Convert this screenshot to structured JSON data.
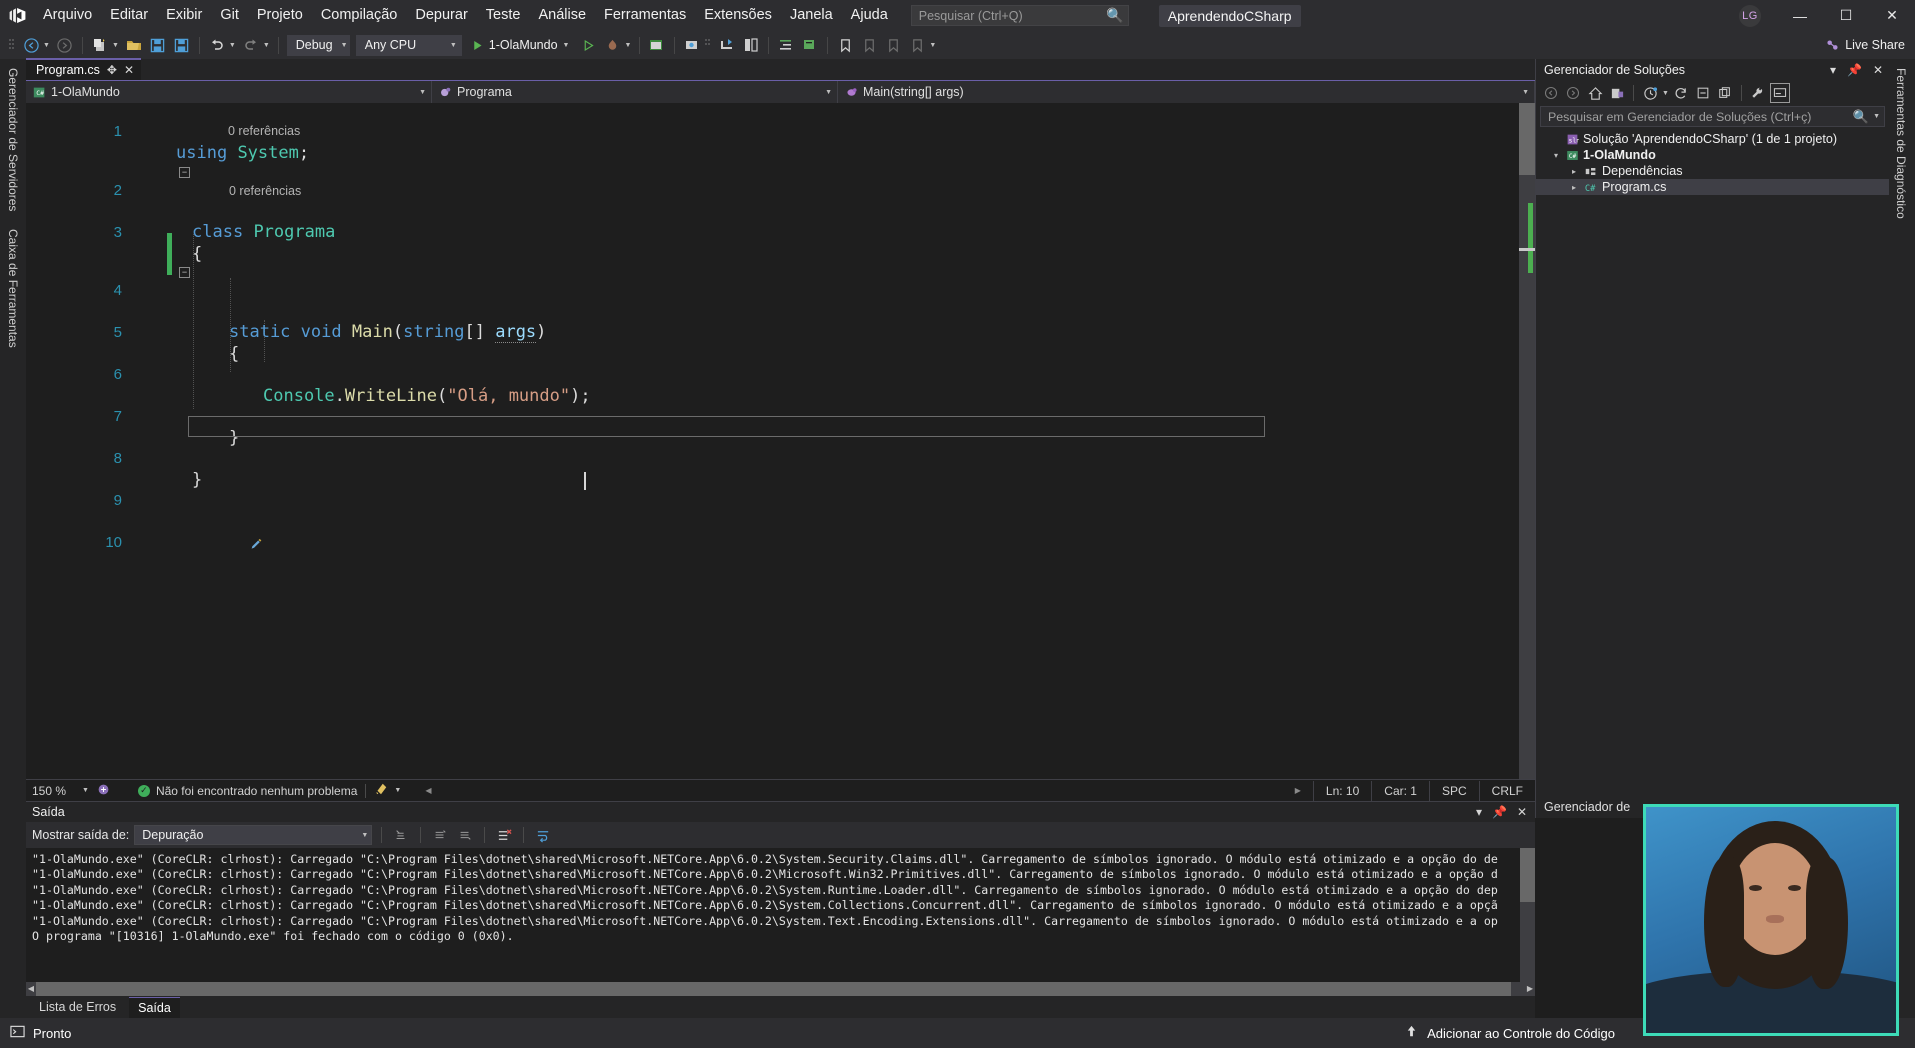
{
  "window": {
    "app_icon": "visual-studio-logo",
    "solution_name": "AprendendoCSharp",
    "user_initials": "LG",
    "minimize": "—",
    "maximize": "☐",
    "close": "✕"
  },
  "menu": {
    "items": [
      "Arquivo",
      "Editar",
      "Exibir",
      "Git",
      "Projeto",
      "Compilação",
      "Depurar",
      "Teste",
      "Análise",
      "Ferramentas",
      "Extensões",
      "Janela",
      "Ajuda"
    ]
  },
  "search": {
    "placeholder": "Pesquisar (Ctrl+Q)",
    "icon": "magnifier-icon"
  },
  "toolbar": {
    "back": "navigate-back-icon",
    "forward": "navigate-forward-icon",
    "new_project": "new-project-icon",
    "open": "open-folder-icon",
    "save": "save-icon",
    "save_all": "save-all-icon",
    "undo": "undo-icon",
    "redo": "redo-icon",
    "configuration": "Debug",
    "platform": "Any CPU",
    "start_label": "1-OlaMundo",
    "start_icon": "play-icon",
    "start_no_debug_icon": "play-outline-icon",
    "hot_reload_icon": "hot-reload-icon",
    "live_share": "Live Share",
    "live_share_icon": "live-share-icon"
  },
  "left_strip": {
    "tabs": [
      "Gerenciador de Servidores",
      "Caixa de Ferramentas"
    ]
  },
  "right_strip": {
    "tabs": [
      "Ferramentas de Diagnóstico"
    ]
  },
  "editor": {
    "tab": {
      "title": "Program.cs",
      "pin": "✥",
      "close": "✕"
    },
    "navbar": {
      "project": "1-OlaMundo",
      "project_icon": "csharp-project-icon",
      "type": "Programa",
      "type_icon": "class-icon",
      "member": "Main(string[] args)",
      "member_icon": "method-icon"
    },
    "lines": [
      {
        "n": "1",
        "segments": [
          {
            "t": "using",
            "c": "k"
          },
          {
            "t": " ",
            "c": "p"
          },
          {
            "t": "System",
            "c": "t"
          },
          {
            "t": ";",
            "c": "p"
          }
        ]
      },
      {
        "n": "2",
        "segments": [
          {
            "t": "class",
            "c": "k"
          },
          {
            "t": " ",
            "c": "p"
          },
          {
            "t": "Programa",
            "c": "t"
          }
        ],
        "indent": 0,
        "fold": "−",
        "ref": "0 referências"
      },
      {
        "n": "3",
        "segments": [
          {
            "t": "{",
            "c": "p"
          }
        ],
        "indent": 1
      },
      {
        "n": "4",
        "segments": [
          {
            "t": "static",
            "c": "k"
          },
          {
            "t": " ",
            "c": "p"
          },
          {
            "t": "void",
            "c": "k"
          },
          {
            "t": " ",
            "c": "p"
          },
          {
            "t": "Main",
            "c": "m"
          },
          {
            "t": "(",
            "c": "p"
          },
          {
            "t": "string",
            "c": "k"
          },
          {
            "t": "[] ",
            "c": "p"
          },
          {
            "t": "args",
            "c": "id"
          },
          {
            "t": ")",
            "c": "p"
          }
        ],
        "indent": 2,
        "fold": "−",
        "ref": "0 referências"
      },
      {
        "n": "5",
        "segments": [
          {
            "t": "{",
            "c": "p"
          }
        ],
        "indent": 2
      },
      {
        "n": "6",
        "segments": [
          {
            "t": "Console",
            "c": "t"
          },
          {
            "t": ".",
            "c": "p"
          },
          {
            "t": "WriteLine",
            "c": "m"
          },
          {
            "t": "(",
            "c": "p"
          },
          {
            "t": "\"Olá, mundo\"",
            "c": "s"
          },
          {
            "t": ");",
            "c": "p"
          }
        ],
        "indent": 3,
        "changed": true
      },
      {
        "n": "7",
        "segments": [
          {
            "t": "}",
            "c": "p"
          }
        ],
        "indent": 2,
        "changed": true
      },
      {
        "n": "8",
        "segments": [
          {
            "t": "}",
            "c": "p"
          }
        ],
        "indent": 1
      },
      {
        "n": "9",
        "segments": []
      },
      {
        "n": "10",
        "segments": [],
        "current": true,
        "marker": "edit-pencil-icon"
      }
    ],
    "status": {
      "zoom": "150 %",
      "problems": "Não foi encontrado nenhum problema",
      "problems_icon": "check-circle-icon",
      "brush_icon": "code-cleanup-icon",
      "line": "Ln: 10",
      "column": "Car: 1",
      "spaces": "SPC",
      "eol": "CRLF"
    }
  },
  "output": {
    "title": "Saída",
    "show_output_label": "Mostrar saída de:",
    "source": "Depuração",
    "icons": [
      "find-message-icon",
      "go-to-previous-icon",
      "go-to-next-icon",
      "clear-all-icon",
      "toggle-word-wrap-icon"
    ],
    "lines": [
      "\"1-OlaMundo.exe\" (CoreCLR: clrhost): Carregado \"C:\\Program Files\\dotnet\\shared\\Microsoft.NETCore.App\\6.0.2\\System.Security.Claims.dll\". Carregamento de símbolos ignorado. O módulo está otimizado e a opção do de",
      "\"1-OlaMundo.exe\" (CoreCLR: clrhost): Carregado \"C:\\Program Files\\dotnet\\shared\\Microsoft.NETCore.App\\6.0.2\\Microsoft.Win32.Primitives.dll\". Carregamento de símbolos ignorado. O módulo está otimizado e a opção d",
      "\"1-OlaMundo.exe\" (CoreCLR: clrhost): Carregado \"C:\\Program Files\\dotnet\\shared\\Microsoft.NETCore.App\\6.0.2\\System.Runtime.Loader.dll\". Carregamento de símbolos ignorado. O módulo está otimizado e a opção do dep",
      "\"1-OlaMundo.exe\" (CoreCLR: clrhost): Carregado \"C:\\Program Files\\dotnet\\shared\\Microsoft.NETCore.App\\6.0.2\\System.Collections.Concurrent.dll\". Carregamento de símbolos ignorado. O módulo está otimizado e a opçã",
      "\"1-OlaMundo.exe\" (CoreCLR: clrhost): Carregado \"C:\\Program Files\\dotnet\\shared\\Microsoft.NETCore.App\\6.0.2\\System.Text.Encoding.Extensions.dll\". Carregamento de símbolos ignorado. O módulo está otimizado e a op",
      "O programa \"[10316] 1-OlaMundo.exe\" foi fechado com o código 0 (0x0)."
    ],
    "tabs": [
      {
        "label": "Lista de Erros",
        "active": false
      },
      {
        "label": "Saída",
        "active": true
      }
    ]
  },
  "solution_explorer": {
    "title": "Gerenciador de Soluções",
    "header_controls": [
      "chevron-down-icon",
      "pin-icon",
      "close-icon"
    ],
    "toolbar_icons": [
      "back-icon",
      "forward-icon",
      "home-icon",
      "sync-with-active-document-icon",
      "pending-changes-icon",
      "refresh-icon",
      "collapse-all-icon",
      "show-all-files-icon",
      "properties-icon",
      "preview-selected-items-icon"
    ],
    "search_placeholder": "Pesquisar em Gerenciador de Soluções (Ctrl+ç)",
    "tree": [
      {
        "label": "Solução 'AprendendoCSharp' (1 de 1 projeto)",
        "indent": 0,
        "icon": "solution-icon",
        "twisty": "",
        "bold": false
      },
      {
        "label": "1-OlaMundo",
        "indent": 1,
        "icon": "csharp-project-icon",
        "twisty": "▾",
        "bold": true
      },
      {
        "label": "Dependências",
        "indent": 2,
        "icon": "dependencies-icon",
        "twisty": "▸",
        "bold": false
      },
      {
        "label": "Program.cs",
        "indent": 2,
        "icon": "csharp-file-icon",
        "twisty": "▸",
        "bold": false,
        "selected": true
      }
    ],
    "footer": "Gerenciador de"
  },
  "statusbar": {
    "ready": "Pronto",
    "ready_icon": "terminal-icon",
    "source_control": "Adicionar ao Controle do Código",
    "source_control_icon": "upload-icon"
  },
  "webcam": {
    "label": "webcam-overlay",
    "border_color": "#3ddbb8"
  },
  "colors": {
    "accent_purple": "#68217a",
    "tab_accent": "#6a5fa8",
    "chrome": "#2d2d30",
    "editor_bg": "#1e1e1e",
    "keyword": "#569cd6",
    "type": "#4ec9b0",
    "method": "#dcdcaa",
    "string": "#d69d85",
    "line_number": "#2b91af",
    "change_bar": "#3fae5a"
  }
}
